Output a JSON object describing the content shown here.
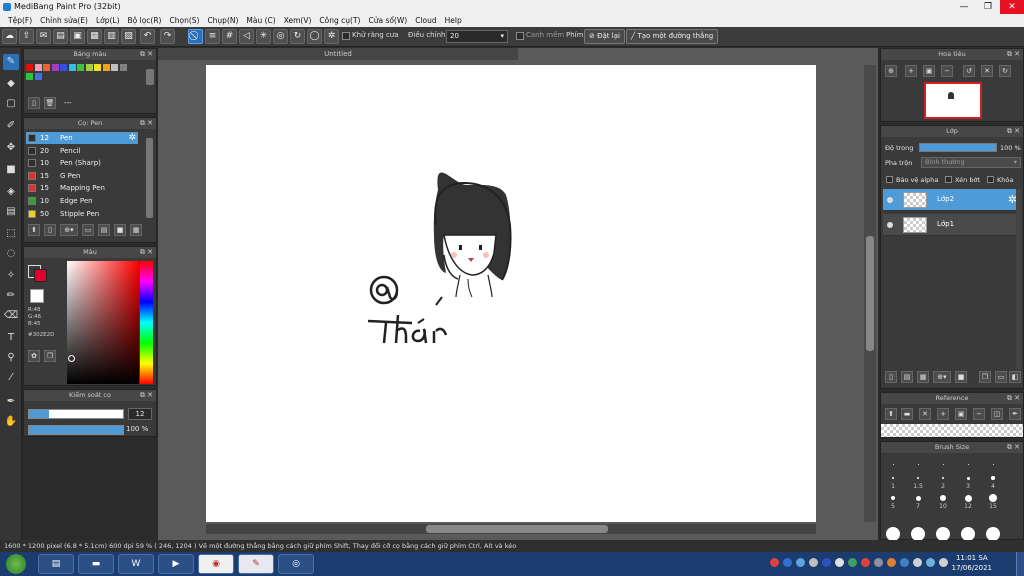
{
  "window": {
    "title": "MediBang Paint Pro (32bit)",
    "minimize": "—",
    "maximize": "❐",
    "close": "✕"
  },
  "menu": [
    "Tệp(F)",
    "Chỉnh sửa(E)",
    "Lớp(L)",
    "Bộ lọc(R)",
    "Chọn(S)",
    "Chụp(N)",
    "Màu (C)",
    "Xem(V)",
    "Công cụ(T)",
    "Cửa sổ(W)",
    "Cloud",
    "Help"
  ],
  "toolbar": {
    "antialias_label": "Khử răng cưa",
    "correction_label": "Điều chỉnh",
    "correction_value": "20",
    "snap_label": "Canh mềm",
    "key_label": "Phím",
    "reset_label": "Đặt lại",
    "create_line_label": "Tạo một đường thẳng"
  },
  "panels": {
    "palette_title": "Bảng màu",
    "palette_extra": "---",
    "brush_title": "Cọ: Pen",
    "color_title": "Màu",
    "rgb": {
      "r": "R:48",
      "g": "G:46",
      "b": "B:45",
      "hex": "#302E2D"
    },
    "brush_control_title": "Kiểm soát cọ",
    "brush_size": "12",
    "brush_opacity": "100 %",
    "navigator_title": "Hoa tiêu",
    "layer_title": "Lớp",
    "opacity_label": "Độ trong",
    "opacity_value": "100 %",
    "blend_label": "Pha trộn",
    "blend_value": "Bình thường",
    "protect_alpha": "Bảo vệ alpha",
    "clip": "Xén bớt",
    "lock": "Khóa",
    "reference_title": "Reference",
    "brushsize_title": "Brush Size"
  },
  "brushes": [
    {
      "size": "12",
      "name": "Pen",
      "color": "#302e2d",
      "selected": true
    },
    {
      "size": "20",
      "name": "Pencil",
      "color": "#302e2d"
    },
    {
      "size": "10",
      "name": "Pen (Sharp)",
      "color": "#302e2d"
    },
    {
      "size": "15",
      "name": "G Pen",
      "color": "#e03030"
    },
    {
      "size": "15",
      "name": "Mapping Pen",
      "color": "#e03030"
    },
    {
      "size": "10",
      "name": "Edge Pen",
      "color": "#30a030"
    },
    {
      "size": "50",
      "name": "Stipple Pen",
      "color": "#f0d020"
    }
  ],
  "layers": [
    {
      "name": "Lớp2",
      "selected": true
    },
    {
      "name": "Lớp1",
      "selected": false
    }
  ],
  "brush_size_presets": [
    {
      "label": "",
      "d": 1
    },
    {
      "label": "",
      "d": 1
    },
    {
      "label": "",
      "d": 1
    },
    {
      "label": "",
      "d": 1
    },
    {
      "label": "",
      "d": 1.5
    },
    {
      "label": "1",
      "d": 2
    },
    {
      "label": "1.5",
      "d": 2
    },
    {
      "label": "2",
      "d": 2.5
    },
    {
      "label": "3",
      "d": 3
    },
    {
      "label": "4",
      "d": 3.5
    },
    {
      "label": "5",
      "d": 4
    },
    {
      "label": "7",
      "d": 5
    },
    {
      "label": "10",
      "d": 6
    },
    {
      "label": "12",
      "d": 7
    },
    {
      "label": "15",
      "d": 8
    }
  ],
  "canvas": {
    "tab": "Untitled"
  },
  "status": "1600 * 1200 pixel  (6.8 * 5.1cm)  600 dpi  59 %  ( 246, 1204 )  Vẽ một đường thẳng bằng cách giữ phím Shift, Thay đổi cỡ cọ bằng cách giữ phím Ctrl, Alt và kéo",
  "clock": {
    "time": "11:01 SA",
    "date": "17/06/2021"
  },
  "colors": {
    "accent": "#4f9bd8",
    "primary": "#e0002d",
    "secondary": "#ffffff"
  }
}
